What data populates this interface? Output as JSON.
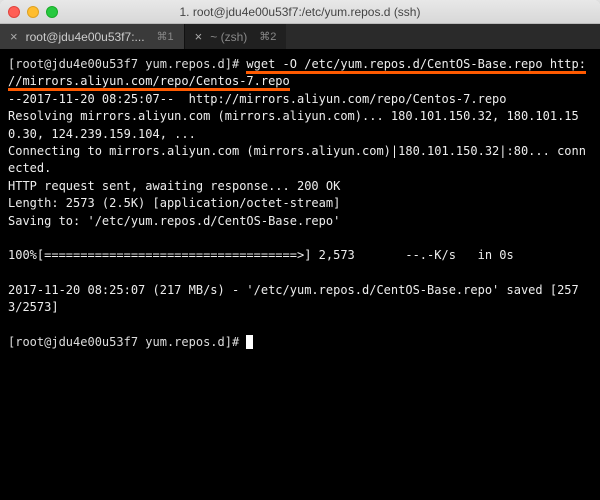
{
  "window": {
    "title": "1. root@jdu4e00u53f7:/etc/yum.repos.d (ssh)"
  },
  "tabs": [
    {
      "label": "root@jdu4e00u53f7:...",
      "hotkey": "⌘1",
      "active": true
    },
    {
      "label": "~ (zsh)",
      "hotkey": "⌘2",
      "active": false
    }
  ],
  "terminal": {
    "prompt1_user": "[root@jdu4e00u53f7 yum.repos.d]# ",
    "cmd_part1": "wget -O /etc/yum.repos.d/CentOS-Base.repo http:",
    "cmd_part2": "//mirrors.aliyun.com/repo/Centos-7.repo",
    "line_ts": "--2017-11-20 08:25:07--  http://mirrors.aliyun.com/repo/Centos-7.repo",
    "line_resolve": "Resolving mirrors.aliyun.com (mirrors.aliyun.com)... 180.101.150.32, 180.101.150.30, 124.239.159.104, ...",
    "line_connect": "Connecting to mirrors.aliyun.com (mirrors.aliyun.com)|180.101.150.32|:80... connected.",
    "line_http": "HTTP request sent, awaiting response... 200 OK",
    "line_length": "Length: 2573 (2.5K) [application/octet-stream]",
    "line_saving": "Saving to: '/etc/yum.repos.d/CentOS-Base.repo'",
    "progress": "100%[===================================>] 2,573       --.-K/s   in 0s",
    "line_saved": "2017-11-20 08:25:07 (217 MB/s) - '/etc/yum.repos.d/CentOS-Base.repo' saved [2573/2573]",
    "prompt2": "[root@jdu4e00u53f7 yum.repos.d]# "
  }
}
